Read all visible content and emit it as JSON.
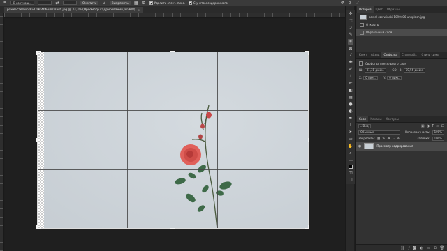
{
  "options_bar": {
    "ratio_dropdown": "В соотнош...",
    "clear_label": "Очистить",
    "straighten_label": "Выпрямить",
    "delete_cropped_label": "Удалить отсеч. пикс.",
    "content_aware_label": "С учетом содержимого"
  },
  "document": {
    "tab_title": "pawel-czerwinski-1090406-unsplash.jpg @ 33,3% (Просмотр кадрирования, RGB/8)",
    "close_symbol": "×"
  },
  "history_panel": {
    "tabs": [
      "История",
      "Цвет",
      "Образцы"
    ],
    "items": [
      {
        "label": "pawel-czerwinski-1090406-unsplash.jpg",
        "type": "snapshot"
      },
      {
        "label": "Открыть",
        "type": "step"
      },
      {
        "label": "Обрезанный слой",
        "type": "step"
      }
    ]
  },
  "properties_panel": {
    "tabs": [
      "Комп",
      "Абзац",
      "Свойства",
      "Стили абз.",
      "Стили симв."
    ],
    "title": "Свойства пиксельного слоя",
    "w_label": "Ш:",
    "w_value": "81,31 дюйм.",
    "link_label": "GO",
    "h_label": "В:",
    "h_value": "50,56 дюйм.",
    "x_label": "X:",
    "x_value": "0 пикс.",
    "y_label": "Y:",
    "y_value": "0 пикс."
  },
  "layers_panel": {
    "tabs": [
      "Слои",
      "Каналы",
      "Контуры"
    ],
    "filter_label": "Вид",
    "blend_mode": "Обычные",
    "opacity_label": "Непрозрачность:",
    "opacity_value": "100%",
    "lock_label": "Закрепить:",
    "fill_label": "Заливка:",
    "fill_value": "100%",
    "layers": [
      {
        "name": "Просмотр кадрирования",
        "visible": true
      }
    ]
  },
  "colors": {
    "accent": "#4b4b4b",
    "canvas_bg": "#1f1f1f",
    "panel_bg": "#323232"
  }
}
